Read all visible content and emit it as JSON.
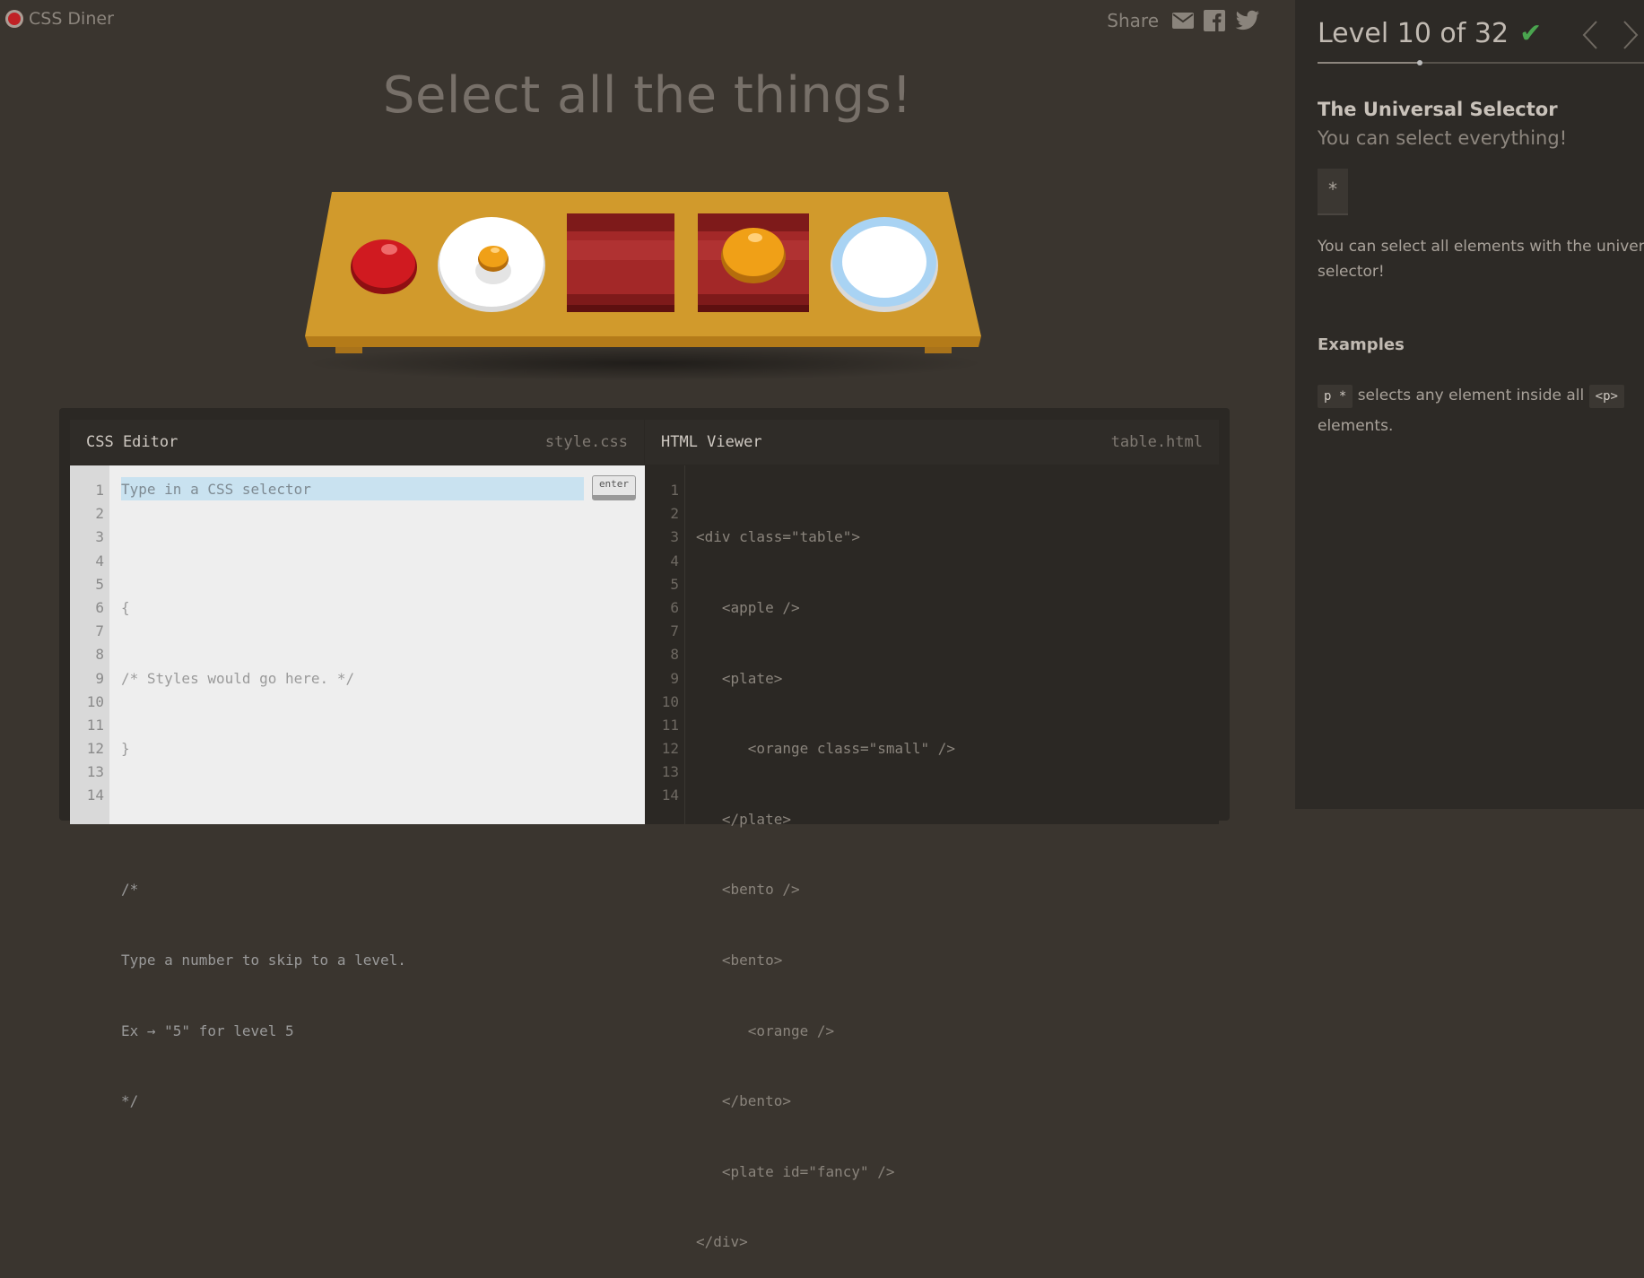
{
  "header": {
    "logo_text": "CSS Diner",
    "share_label": "Share"
  },
  "title": "Select all the things!",
  "table_items": [
    "apple",
    "orange",
    "plate",
    "bento",
    "bento",
    "orange",
    "plate"
  ],
  "css_editor": {
    "title": "CSS Editor",
    "filename": "style.css",
    "placeholder": "Type in a CSS selector",
    "enter_label": "enter",
    "line_numbers": [
      "1",
      "2",
      "3",
      "4",
      "5",
      "6",
      "7",
      "8",
      "9",
      "10",
      "11",
      "12",
      "13",
      "14"
    ],
    "lines": [
      "",
      "{",
      "/* Styles would go here. */",
      "}",
      "",
      "/*",
      "Type a number to skip to a level.",
      "Ex → \"5\" for level 5",
      "*/"
    ]
  },
  "html_viewer": {
    "title": "HTML Viewer",
    "filename": "table.html",
    "line_numbers": [
      "1",
      "2",
      "3",
      "4",
      "5",
      "6",
      "7",
      "8",
      "9",
      "10",
      "11",
      "12",
      "13",
      "14"
    ],
    "lines": [
      "<div class=\"table\">",
      "   <apple />",
      "   <plate>",
      "      <orange class=\"small\" />",
      "   </plate>",
      "   <bento />",
      "   <bento>",
      "      <orange />",
      "   </bento>",
      "   <plate id=\"fancy\" />",
      "</div>"
    ]
  },
  "sidebar": {
    "level_text": "Level 10 of 32",
    "check": "✔",
    "progress_fraction": 0.3125,
    "selector_name": "The Universal Selector",
    "selector_subtitle": "You can select everything!",
    "syntax": "*",
    "description_line1": "You can select all elements with the universal",
    "description_line2": "selector!",
    "examples_heading": "Examples",
    "example_code": "p *",
    "example_text": "selects any element inside all",
    "example_tag": "<p>",
    "example_text2": "elements."
  },
  "colors": {
    "background": "#3a352f",
    "sidebar": "#2d2a26",
    "table": "#d09429",
    "apple": "#c6161c",
    "orange": "#f0a017",
    "bento": "#8f1f1f",
    "check": "#4aa54f"
  },
  "icons": [
    "email-icon",
    "facebook-icon",
    "twitter-icon",
    "chevron-left-icon",
    "chevron-right-icon"
  ]
}
